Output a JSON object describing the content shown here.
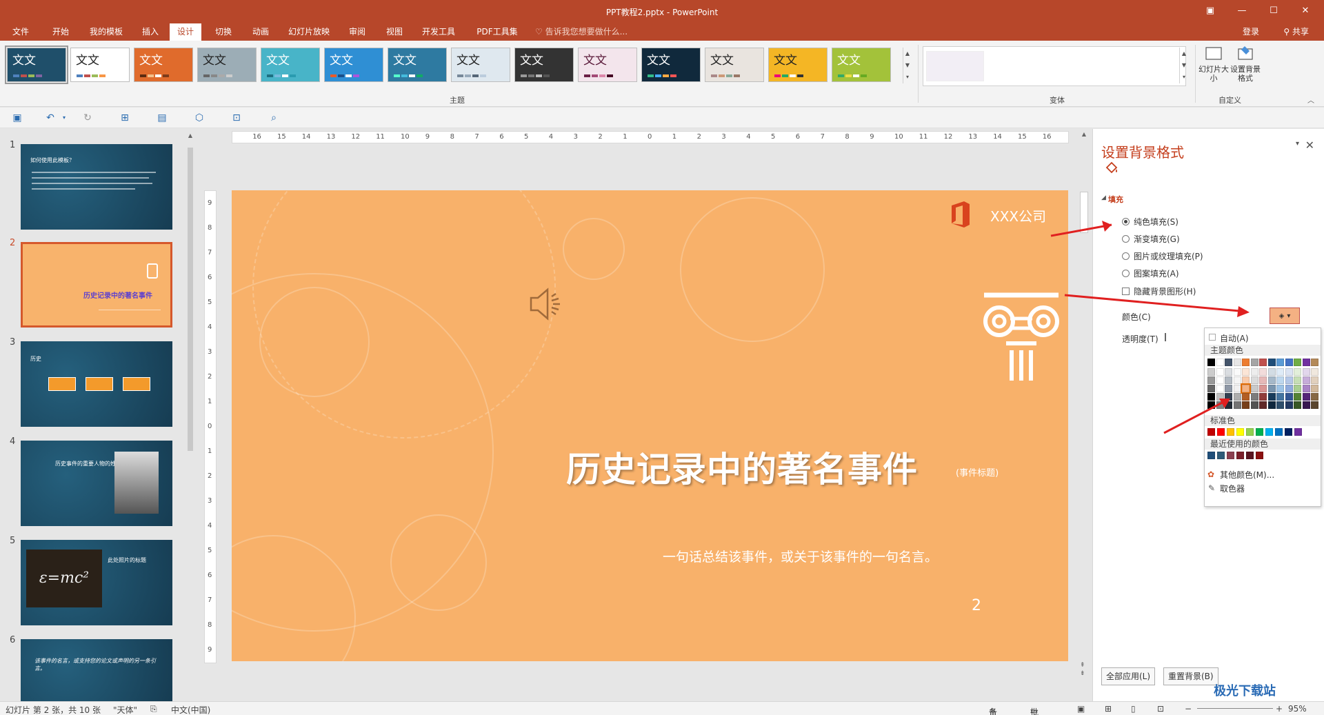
{
  "window": {
    "title": "PPT教程2.pptx - PowerPoint",
    "controls": [
      "restore-icon",
      "minimize-icon",
      "maximize-icon",
      "close-icon"
    ]
  },
  "menu": {
    "tabs": [
      "文件",
      "开始",
      "我的模板",
      "插入",
      "设计",
      "切换",
      "动画",
      "幻灯片放映",
      "审阅",
      "视图",
      "开发工具",
      "PDF工具集"
    ],
    "active": "设计",
    "tell_me": "告诉我您想要做什么...",
    "login": "登录",
    "share": "共享"
  },
  "ribbon": {
    "theme_label": "文文",
    "themes": [
      {
        "bg": "#1f4f6a",
        "fg": "#ffffff",
        "bars": [
          "#4f81bd",
          "#c0504d",
          "#9bbb59",
          "#8064a2"
        ]
      },
      {
        "bg": "#ffffff",
        "fg": "#222222",
        "bars": [
          "#4f81bd",
          "#c0504d",
          "#9bbb59",
          "#f79646"
        ]
      },
      {
        "bg": "#e06b2c",
        "fg": "#ffffff",
        "bars": [
          "#5c2b10",
          "#f3c08a",
          "#ffffff",
          "#7d3b1a"
        ]
      },
      {
        "bg": "#9cadb6",
        "fg": "#222222",
        "bars": [
          "#666",
          "#888",
          "#aaa",
          "#ccc"
        ]
      },
      {
        "bg": "#48b4c8",
        "fg": "#ffffff",
        "bars": [
          "#1d6f82",
          "#7bd",
          "#ffffff",
          "#2a9bb0"
        ]
      },
      {
        "bg": "#2f8fd4",
        "fg": "#ffffff",
        "bars": [
          "#e85b2a",
          "#1a4f8a",
          "#ffffff",
          "#a5d"
        ]
      },
      {
        "bg": "#2e7aa1",
        "fg": "#ffffff",
        "bars": [
          "#5fc",
          "#4bd",
          "#fff",
          "#1a6"
        ]
      },
      {
        "bg": "#dfe8ef",
        "fg": "#222222",
        "bars": [
          "#789",
          "#9ab",
          "#567",
          "#bcd"
        ]
      },
      {
        "bg": "#333333",
        "fg": "#ffffff",
        "bars": [
          "#999",
          "#777",
          "#bbb",
          "#555"
        ]
      },
      {
        "bg": "#f3e5ec",
        "fg": "#5a1a3a",
        "bars": [
          "#6b1f45",
          "#a34b76",
          "#d8a",
          "#402"
        ]
      },
      {
        "bg": "#10293c",
        "fg": "#ffffff",
        "bars": [
          "#3b8",
          "#4af",
          "#fa4",
          "#f55"
        ]
      },
      {
        "bg": "#e9e4df",
        "fg": "#222222",
        "bars": [
          "#a88",
          "#c97",
          "#8a9",
          "#976"
        ]
      },
      {
        "bg": "#f4b625",
        "fg": "#222222",
        "bars": [
          "#e07",
          "#2a6",
          "#fff",
          "#333"
        ]
      },
      {
        "bg": "#a3c23a",
        "fg": "#ffffff",
        "bars": [
          "#3a6",
          "#ed4",
          "#fff",
          "#6a2"
        ]
      }
    ],
    "groups": {
      "theme": "主题",
      "variant": "变体",
      "customize": "自定义"
    },
    "slide_size": "幻灯片大小",
    "format_bg": "设置背景格式"
  },
  "thumbs": [
    {
      "num": "1",
      "title": "如何使用此模板？",
      "active": false
    },
    {
      "num": "2",
      "title": "历史记录中的著名事件",
      "active": true
    },
    {
      "num": "3",
      "title": "历史",
      "active": false
    },
    {
      "num": "4",
      "title": "历史事件的重要人物的姓名",
      "active": false
    },
    {
      "num": "5",
      "title": "此处照片的标题",
      "active": false
    },
    {
      "num": "6",
      "title": "该事件的名言，或支持您的论文或声明的另一条引言。",
      "active": false
    }
  ],
  "slide": {
    "company": "XXX公司",
    "title": "历史记录中的著名事件",
    "title_tag": "(事件标题)",
    "subtitle": "一句话总结该事件，或关于该事件的一句名言。",
    "page": "2"
  },
  "pane": {
    "title": "设置背景格式",
    "section": "填充",
    "options": [
      {
        "label": "纯色填充(S)",
        "checked": true
      },
      {
        "label": "渐变填充(G)",
        "checked": false
      },
      {
        "label": "图片或纹理填充(P)",
        "checked": false
      },
      {
        "label": "图案填充(A)",
        "checked": false
      }
    ],
    "hide_bg": "隐藏背景图形(H)",
    "color_label": "颜色(C)",
    "transparency_label": "透明度(T)",
    "apply_all": "全部应用(L)",
    "reset_bg": "重置背景(B)"
  },
  "color_menu": {
    "auto": "自动(A)",
    "theme_colors": "主题颜色",
    "standard_colors": "标准色",
    "recent_colors": "最近使用的颜色",
    "more_colors": "其他颜色(M)...",
    "eyedropper": "取色器",
    "theme_top": [
      "#000000",
      "#ffffff",
      "#44546a",
      "#e7e6e6",
      "#ed7d31",
      "#a5a5a5",
      "#c0504d",
      "#1f4e79",
      "#5b9bd5",
      "#4472c4",
      "#70ad47",
      "#7030a0",
      "#b48a5a"
    ],
    "standard": [
      "#c00000",
      "#ff0000",
      "#ffc000",
      "#ffff00",
      "#92d050",
      "#00b050",
      "#00b0f0",
      "#0070c0",
      "#002060",
      "#7030a0"
    ],
    "recent": [
      "#1f4e79",
      "#2e5b78",
      "#8b4050",
      "#7a1f2a",
      "#5a1520",
      "#8b1010"
    ]
  },
  "status": {
    "slide_info": "幻灯片 第 2 张，共 10 张",
    "theme": "\"天体\"",
    "language": "中文(中国)",
    "notes": "备注",
    "comments": "批注",
    "zoom": "95%"
  },
  "watermark": "极光下载站"
}
